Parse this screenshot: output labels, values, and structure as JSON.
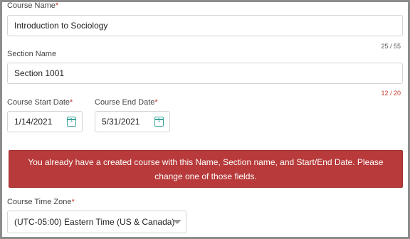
{
  "course_name": {
    "label": "Course Name",
    "required_mark": "*",
    "value": "Introduction to Sociology",
    "counter": "25 / 55"
  },
  "section_name": {
    "label": "Section Name",
    "value": "Section 1001",
    "counter": "12 / 20"
  },
  "start_date": {
    "label": "Course Start Date",
    "required_mark": "*",
    "value": "1/14/2021",
    "icon_day": "1"
  },
  "end_date": {
    "label": "Course End Date",
    "required_mark": "*",
    "value": "5/31/2021",
    "icon_day": "1"
  },
  "error_alert": {
    "message": "You already have a created course with this Name, Section name, and Start/End Date. Please change one of those fields."
  },
  "time_zone": {
    "label": "Course Time Zone",
    "required_mark": "*",
    "value": "(UTC-05:00) Eastern Time (US & Canada)"
  },
  "colors": {
    "error": "#b83a3a",
    "required": "#c0392b",
    "calendar_icon": "#3aa39a"
  },
  "icons": {
    "calendar": "calendar-icon",
    "dropdown": "chevron-down-icon"
  }
}
